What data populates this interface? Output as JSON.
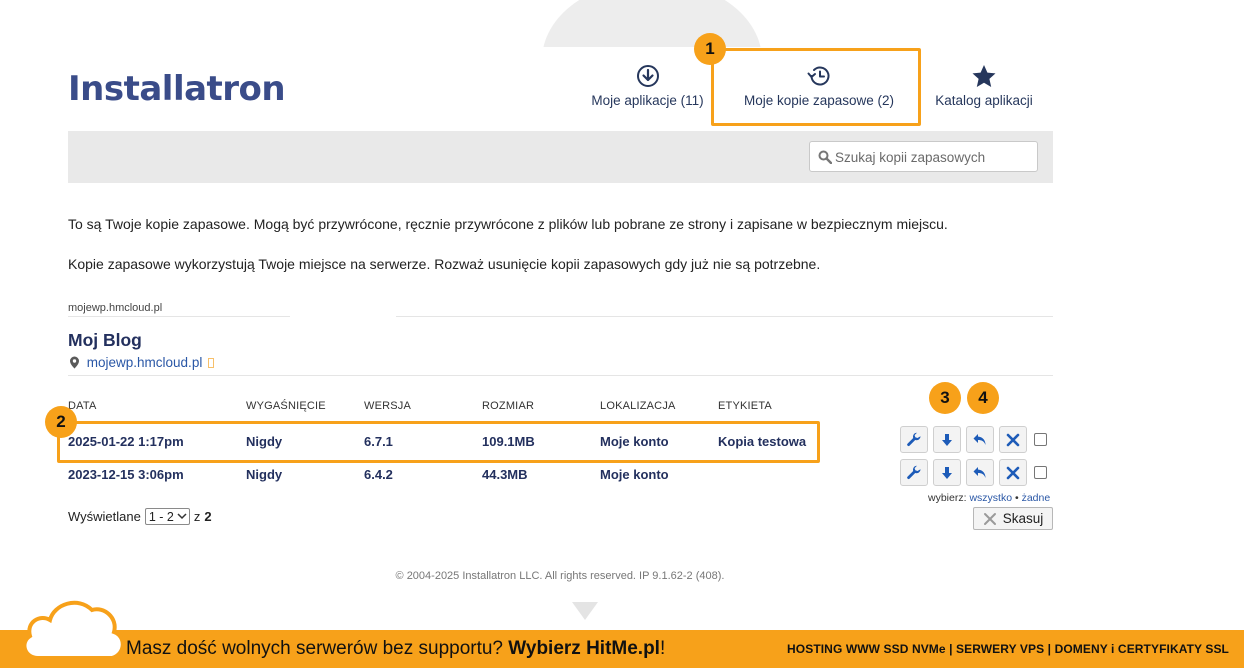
{
  "app": {
    "logo_text": "Installatron"
  },
  "nav": {
    "apps_label": "Moje aplikacje (11)",
    "backups_label": "Moje kopie zapasowe (2)",
    "catalog_label": "Katalog aplikacji"
  },
  "search": {
    "placeholder": "Szukaj kopii zapasowych"
  },
  "intro": {
    "line1": "To są Twoje kopie zapasowe. Mogą być przywrócone, ręcznie przywrócone z plików lub pobrane ze strony i zapisane w bezpiecznym miejscu.",
    "line2": "Kopie zapasowe wykorzystują Twoje miejsce na serwerze. Rozważ usunięcie kopii zapasowych gdy już nie są potrzebne."
  },
  "domain_tab": "mojewp.hmcloud.pl",
  "site": {
    "title": "Moj Blog",
    "url": "mojewp.hmcloud.pl"
  },
  "table": {
    "headers": [
      "DATA",
      "WYGAŚNIĘCIE",
      "WERSJA",
      "ROZMIAR",
      "LOKALIZACJA",
      "ETYKIETA"
    ],
    "rows": [
      [
        "2025-01-22 1:17pm",
        "Nigdy",
        "6.7.1",
        "109.1MB",
        "Moje konto",
        "Kopia testowa"
      ],
      [
        "2023-12-15 3:06pm",
        "Nigdy",
        "6.4.2",
        "44.3MB",
        "Moje konto",
        ""
      ]
    ]
  },
  "select": {
    "prefix": "wybierz:",
    "all": "wszystko",
    "sep": "•",
    "none": "żadne"
  },
  "delete_label": "Skasuj",
  "paging": {
    "shown": "Wyświetlane",
    "range": "1 - 2",
    "of": "z",
    "total": "2"
  },
  "copyright": "© 2004-2025 Installatron LLC. All rights reserved. IP 9.1.62-2 (408).",
  "badges": [
    "1",
    "2",
    "3",
    "4"
  ],
  "banner": {
    "promo_text": "Masz dość wolnych serwerów bez supportu?",
    "promo_bold": "Wybierz HitMe.pl",
    "promo_end": "!",
    "services": "HOSTING WWW SSD NVMe | SERWERY VPS | DOMENY i CERTYFIKATY SSL"
  },
  "colors": {
    "accent": "#f7a11a",
    "navy": "#23305e",
    "link": "#2a57a6",
    "toolbar": "#e9e9e9"
  }
}
